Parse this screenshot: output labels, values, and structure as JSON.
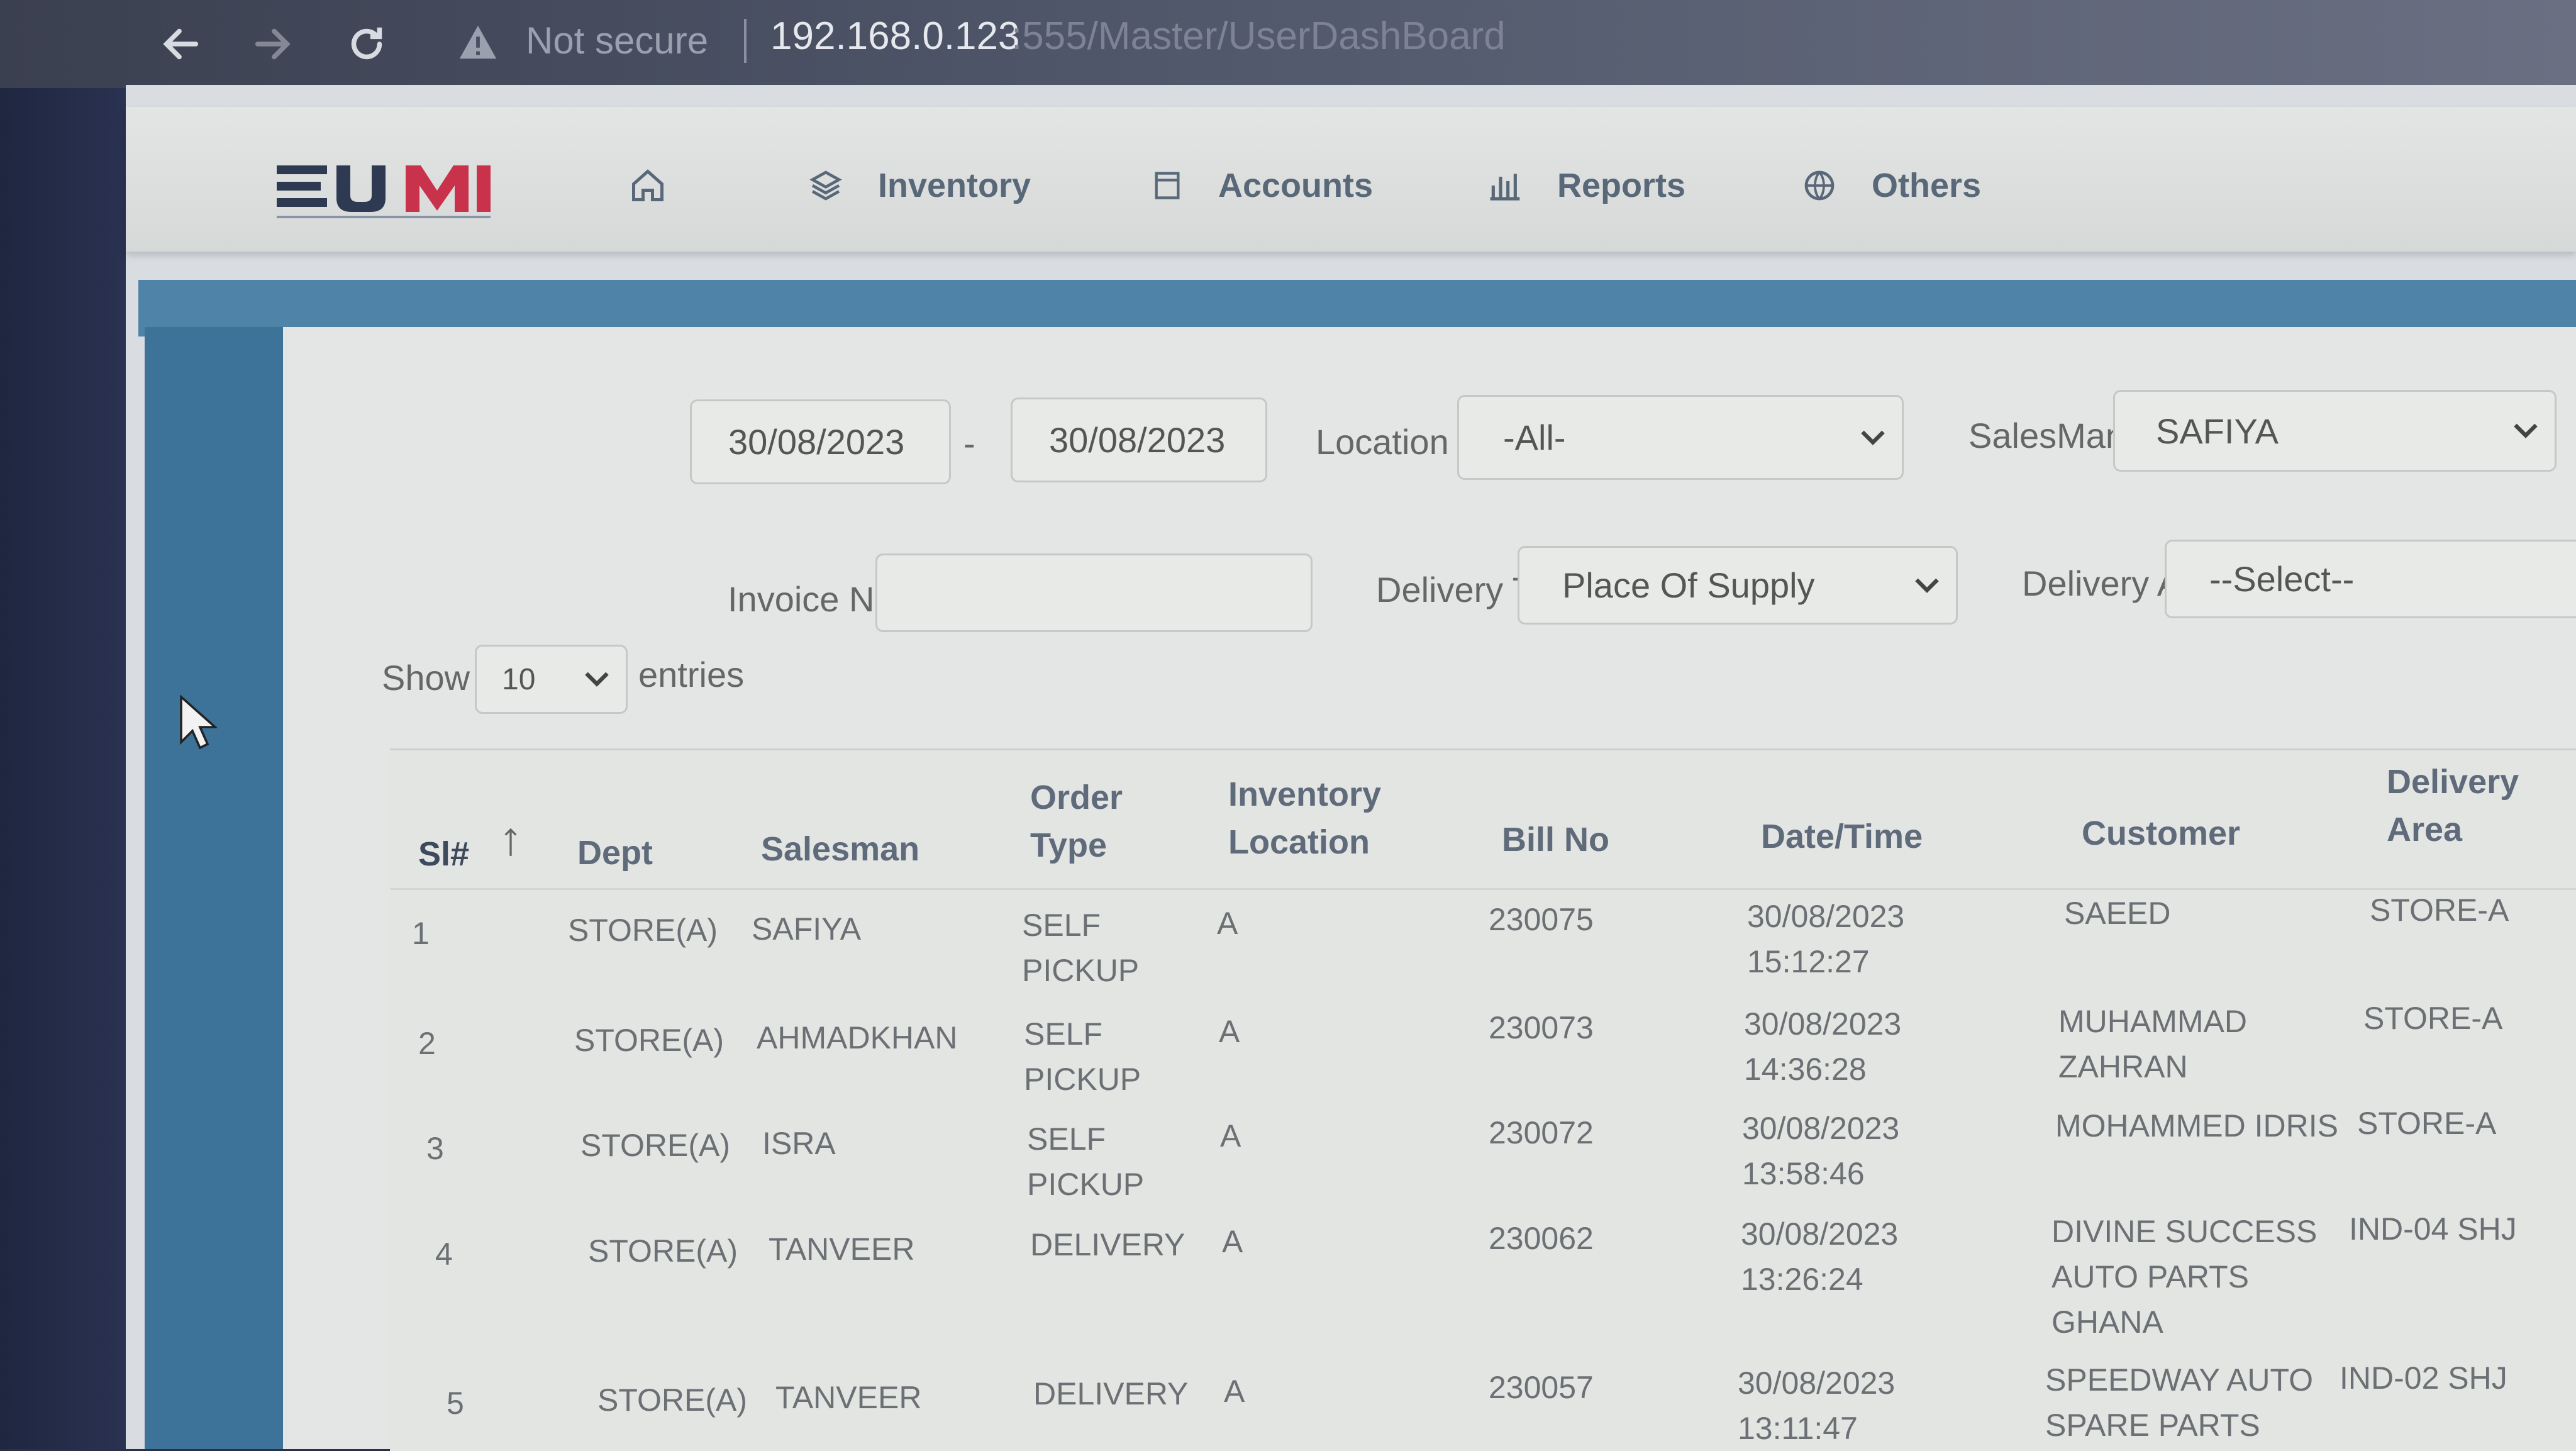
{
  "browser": {
    "security_text": "Not secure",
    "url_host": "192.168.0.123",
    "url_path": ":555/Master/UserDashBoard"
  },
  "nav": {
    "items": [
      {
        "label": "Inventory"
      },
      {
        "label": "Accounts"
      },
      {
        "label": "Reports"
      },
      {
        "label": "Others"
      }
    ]
  },
  "filters": {
    "date_from": "30/08/2023",
    "date_separator": "-",
    "date_to": "30/08/2023",
    "location_label": "Location",
    "location_value": "-All-",
    "salesman_label": "SalesMan",
    "salesman_value": "SAFIYA",
    "invoice_label": "Invoice N",
    "invoice_value": "",
    "delivery_type_label": "Delivery T",
    "delivery_type_value": "Place Of Supply",
    "delivery_area_label": "Delivery A",
    "delivery_area_value": "--Select--",
    "show_label": "Show",
    "entries_value": "10",
    "entries_label": "entries"
  },
  "table": {
    "headers": {
      "sl": "Sl#",
      "dept": "Dept",
      "salesman": "Salesman",
      "order_type": "Order\nType",
      "inventory_location": "Inventory\nLocation",
      "bill_no": "Bill No",
      "datetime": "Date/Time",
      "customer": "Customer",
      "delivery_area": "Delivery\nArea"
    },
    "rows": [
      {
        "sl": "1",
        "dept": "STORE(A)",
        "salesman": "SAFIYA",
        "order_type": "SELF\nPICKUP",
        "inv_loc": "A",
        "bill_no": "230075",
        "datetime": "30/08/2023\n15:12:27",
        "customer": "SAEED",
        "area": "STORE-A"
      },
      {
        "sl": "2",
        "dept": "STORE(A)",
        "salesman": "AHMADKHAN",
        "order_type": "SELF\nPICKUP",
        "inv_loc": "A",
        "bill_no": "230073",
        "datetime": "30/08/2023\n14:36:28",
        "customer": "MUHAMMAD\nZAHRAN",
        "area": "STORE-A"
      },
      {
        "sl": "3",
        "dept": "STORE(A)",
        "salesman": "ISRA",
        "order_type": "SELF\nPICKUP",
        "inv_loc": "A",
        "bill_no": "230072",
        "datetime": "30/08/2023\n13:58:46",
        "customer": "MOHAMMED IDRIS",
        "area": "STORE-A"
      },
      {
        "sl": "4",
        "dept": "STORE(A)",
        "salesman": "TANVEER",
        "order_type": "DELIVERY",
        "inv_loc": "A",
        "bill_no": "230062",
        "datetime": "30/08/2023\n13:26:24",
        "customer": "DIVINE SUCCESS\nAUTO PARTS\nGHANA",
        "area": "IND-04 SHJ"
      },
      {
        "sl": "5",
        "dept": "STORE(A)",
        "salesman": "TANVEER",
        "order_type": "DELIVERY",
        "inv_loc": "A",
        "bill_no": "230057",
        "datetime": "30/08/2023\n13:11:47",
        "customer": "SPEEDWAY AUTO\nSPARE PARTS",
        "area": "IND-02 SHJ"
      }
    ]
  },
  "colors": {
    "nav_text": "#596879",
    "content_blue": "#3d7399",
    "card_bg": "#e4e6e5"
  },
  "icons": [
    "back-arrow-icon",
    "forward-arrow-icon",
    "reload-icon",
    "warning-icon",
    "home-icon",
    "layers-icon",
    "book-icon",
    "bar-chart-icon",
    "globe-icon",
    "chevron-down-icon",
    "sort-asc-icon",
    "mouse-cursor-icon"
  ]
}
